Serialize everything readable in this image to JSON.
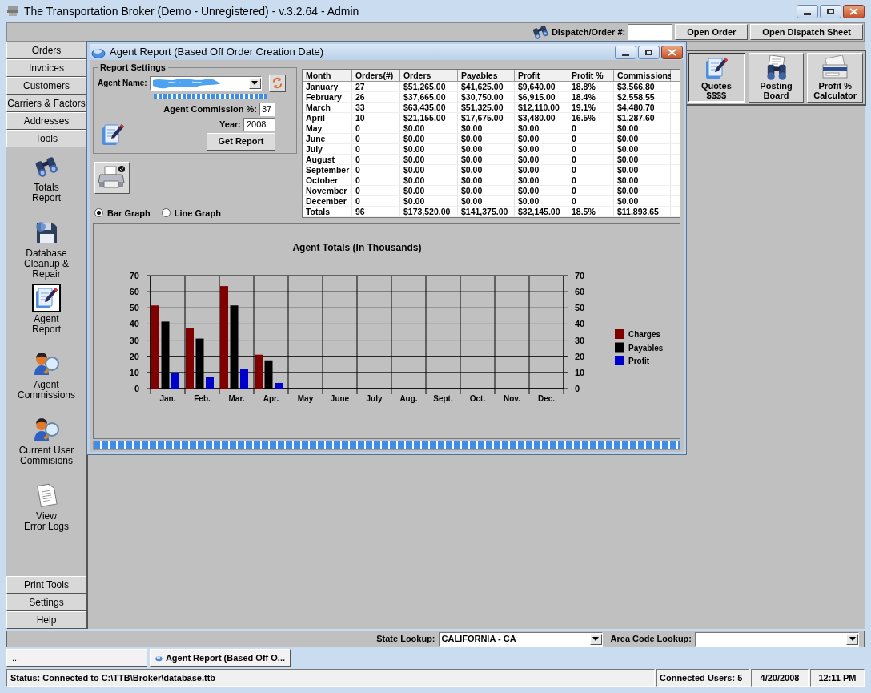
{
  "window": {
    "title": "The Transportation Broker (Demo - Unregistered) - v.3.2.64 - Admin"
  },
  "toolbar": {
    "dispatch_label": "Dispatch/Order #:",
    "buttons": [
      "Open Order",
      "Open Dispatch Sheet"
    ]
  },
  "sidebar": {
    "nav": [
      "Orders",
      "Invoices",
      "Customers",
      "Carriers & Factors",
      "Addresses",
      "Tools"
    ],
    "tools": [
      {
        "label": "Totals\nReport",
        "selected": false
      },
      {
        "label": "Database\nCleanup &\nRepair",
        "selected": false
      },
      {
        "label": "Agent\nReport",
        "selected": true
      },
      {
        "label": "Agent\nCommissions",
        "selected": false
      },
      {
        "label": "Current User\nCommisions",
        "selected": false
      },
      {
        "label": "View\nError Logs",
        "selected": false
      }
    ],
    "bottom": [
      "Print Tools",
      "Settings",
      "Help"
    ]
  },
  "quick_buttons": [
    {
      "label": "Quotes\n$$$$",
      "selected": true
    },
    {
      "label": "Posting\nBoard",
      "selected": false
    },
    {
      "label": "Profit %\nCalculator",
      "selected": false
    }
  ],
  "report_window": {
    "title": "Agent Report (Based Off Order Creation Date)",
    "settings": {
      "legend": "Report Settings",
      "agent_label": "Agent Name:",
      "agent_progress": {
        "level": 1
      },
      "commission_label": "Agent Commission %:",
      "commission": "37",
      "year_label": "Year:",
      "year": "2008",
      "button": "Get Report"
    },
    "graph_options": [
      {
        "label": "Bar Graph",
        "selected": true
      },
      {
        "label": "Line Graph",
        "selected": false
      }
    ],
    "table": {
      "columns": [
        "Month",
        "Orders(#)",
        "Orders",
        "Payables",
        "Profit",
        "Profit %",
        "Commissions"
      ],
      "rows": [
        [
          "January",
          "27",
          "$51,265.00",
          "$41,625.00",
          "$9,640.00",
          "18.8%",
          "$3,566.80"
        ],
        [
          "February",
          "26",
          "$37,665.00",
          "$30,750.00",
          "$6,915.00",
          "18.4%",
          "$2,558.55"
        ],
        [
          "March",
          "33",
          "$63,435.00",
          "$51,325.00",
          "$12,110.00",
          "19.1%",
          "$4,480.70"
        ],
        [
          "April",
          "10",
          "$21,155.00",
          "$17,675.00",
          "$3,480.00",
          "16.5%",
          "$1,287.60"
        ],
        [
          "May",
          "0",
          "$0.00",
          "$0.00",
          "$0.00",
          "0",
          "$0.00"
        ],
        [
          "June",
          "0",
          "$0.00",
          "$0.00",
          "$0.00",
          "0",
          "$0.00"
        ],
        [
          "July",
          "0",
          "$0.00",
          "$0.00",
          "$0.00",
          "0",
          "$0.00"
        ],
        [
          "August",
          "0",
          "$0.00",
          "$0.00",
          "$0.00",
          "0",
          "$0.00"
        ],
        [
          "September",
          "0",
          "$0.00",
          "$0.00",
          "$0.00",
          "0",
          "$0.00"
        ],
        [
          "October",
          "0",
          "$0.00",
          "$0.00",
          "$0.00",
          "0",
          "$0.00"
        ],
        [
          "November",
          "0",
          "$0.00",
          "$0.00",
          "$0.00",
          "0",
          "$0.00"
        ],
        [
          "December",
          "0",
          "$0.00",
          "$0.00",
          "$0.00",
          "0",
          "$0.00"
        ],
        [
          "Totals",
          "96",
          "$173,520.00",
          "$141,375.00",
          "$32,145.00",
          "18.5%",
          "$11,893.65"
        ]
      ]
    },
    "chart_data": {
      "type": "bar",
      "title": "Agent Totals (In Thousands)",
      "categories": [
        "Jan.",
        "Feb.",
        "Mar.",
        "Apr.",
        "May",
        "June",
        "July",
        "Aug.",
        "Sept.",
        "Oct.",
        "Nov.",
        "Dec."
      ],
      "series": [
        {
          "name": "Charges",
          "color": "#800000",
          "values": [
            51.5,
            37.5,
            63.5,
            21,
            0,
            0,
            0,
            0,
            0,
            0,
            0,
            0
          ]
        },
        {
          "name": "Payables",
          "color": "#000000",
          "values": [
            41.5,
            31,
            51.5,
            17.5,
            0,
            0,
            0,
            0,
            0,
            0,
            0,
            0
          ]
        },
        {
          "name": "Profit",
          "color": "#0000cc",
          "values": [
            9.5,
            7,
            12,
            3.5,
            0,
            0,
            0,
            0,
            0,
            0,
            0,
            0
          ]
        }
      ],
      "ylim": [
        0,
        70
      ],
      "yticks": [
        0,
        10,
        20,
        30,
        40,
        50,
        60,
        70
      ],
      "y2lim": [
        0,
        70
      ],
      "y2ticks": [
        0,
        10,
        20,
        30,
        40,
        50,
        60,
        70
      ],
      "grid": true,
      "legend": true
    },
    "progress": {
      "level": 1
    }
  },
  "lookup_bar": {
    "state_label": "State Lookup:",
    "state_value": "CALIFORNIA - CA",
    "area_label": "Area Code Lookup:"
  },
  "taskbar": [
    {
      "label": "...",
      "kind": "blank"
    },
    {
      "label": "Agent Report (Based Off O...",
      "kind": "window"
    }
  ],
  "status_bar": {
    "status": "Status: Connected to C:\\TTB\\Broker\\database.ttb",
    "users": "Connected Users: 5",
    "date": "4/20/2008",
    "time": "12:11 PM"
  }
}
